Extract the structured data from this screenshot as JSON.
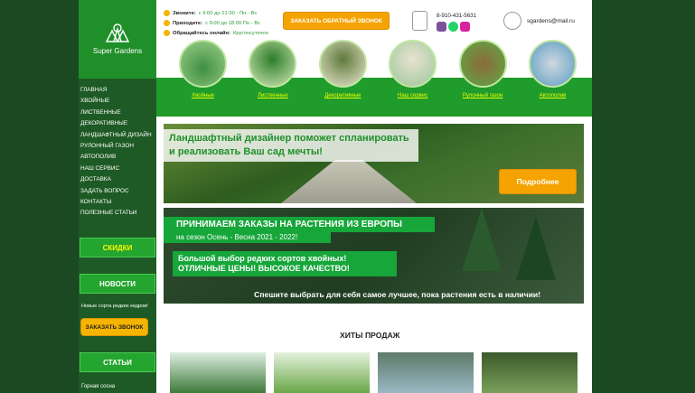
{
  "logo": {
    "text": "Super Gardens"
  },
  "menu": [
    "ГЛАВНАЯ",
    "ХВОЙНЫЕ",
    "ЛИСТВЕННЫЕ",
    "ДЕКОРАТИВНЫЕ",
    "ЛАНДШАФТНЫЙ ДИЗАЙН",
    "РУЛОННЫЙ ГАЗОН",
    "АВТОПОЛИВ",
    "НАШ СЕРВИС",
    "ДОСТАВКА",
    "ЗАДАТЬ ВОПРОС",
    "КОНТАКТЫ",
    "ПОЛЕЗНЫЕ СТАТЬИ"
  ],
  "sidebar": {
    "discounts": "СКИДКИ",
    "news": "НОВОСТИ",
    "news_item": "Новые сорта редких кедров!",
    "call": "ЗАКАЗАТЬ ЗВОНОК",
    "articles": "СТАТЬИ",
    "article_item": "Горная сосна"
  },
  "header": {
    "call_label": "Звоните:",
    "call_hours": "с 9:00 до 21:00 - Пн - Вс",
    "visit_label": "Приходите:",
    "visit_hours": "с 9:00 до 18:00 Пн - Вс",
    "online_label": "Обращайтесь онлайн:",
    "online_hours": "Круглосуточно",
    "cta": "ЗАКАЗАТЬ ОБРАТНЫЙ ЗВОНОК",
    "phone": "8-910-431-5631",
    "email": "sgardens@mail.ru"
  },
  "categories": [
    "Хвойные",
    "Лиственные",
    "Декоративные",
    "Наш сервис",
    "Рулонный газон",
    "Автополив"
  ],
  "banner1": {
    "text1": "Ландшафтный дизайнер поможет спланировать",
    "text2": "и реализовать Ваш сад мечты!",
    "button": "Подробнее"
  },
  "banner2": {
    "heading": "ПРИНИМАЕМ ЗАКАЗЫ НА РАСТЕНИЯ ИЗ ЕВРОПЫ",
    "season": "на сезон Осень - Весна 2021 - 2022!",
    "promo1": "Большой выбор редких сортов хвойных!",
    "promo2": "ОТЛИЧНЫЕ ЦЕНЫ! ВЫСОКОЕ КАЧЕСТВО!",
    "footer": "Спешите выбрать для себя самое лучшее, пока растения есть в наличии!"
  },
  "hits": {
    "title": "ХИТЫ ПРОДАЖ"
  },
  "colors": {
    "green": "#1f9c2b",
    "dark": "#1b4a22",
    "orange": "#f5a300",
    "yellow": "#e6ff00"
  }
}
